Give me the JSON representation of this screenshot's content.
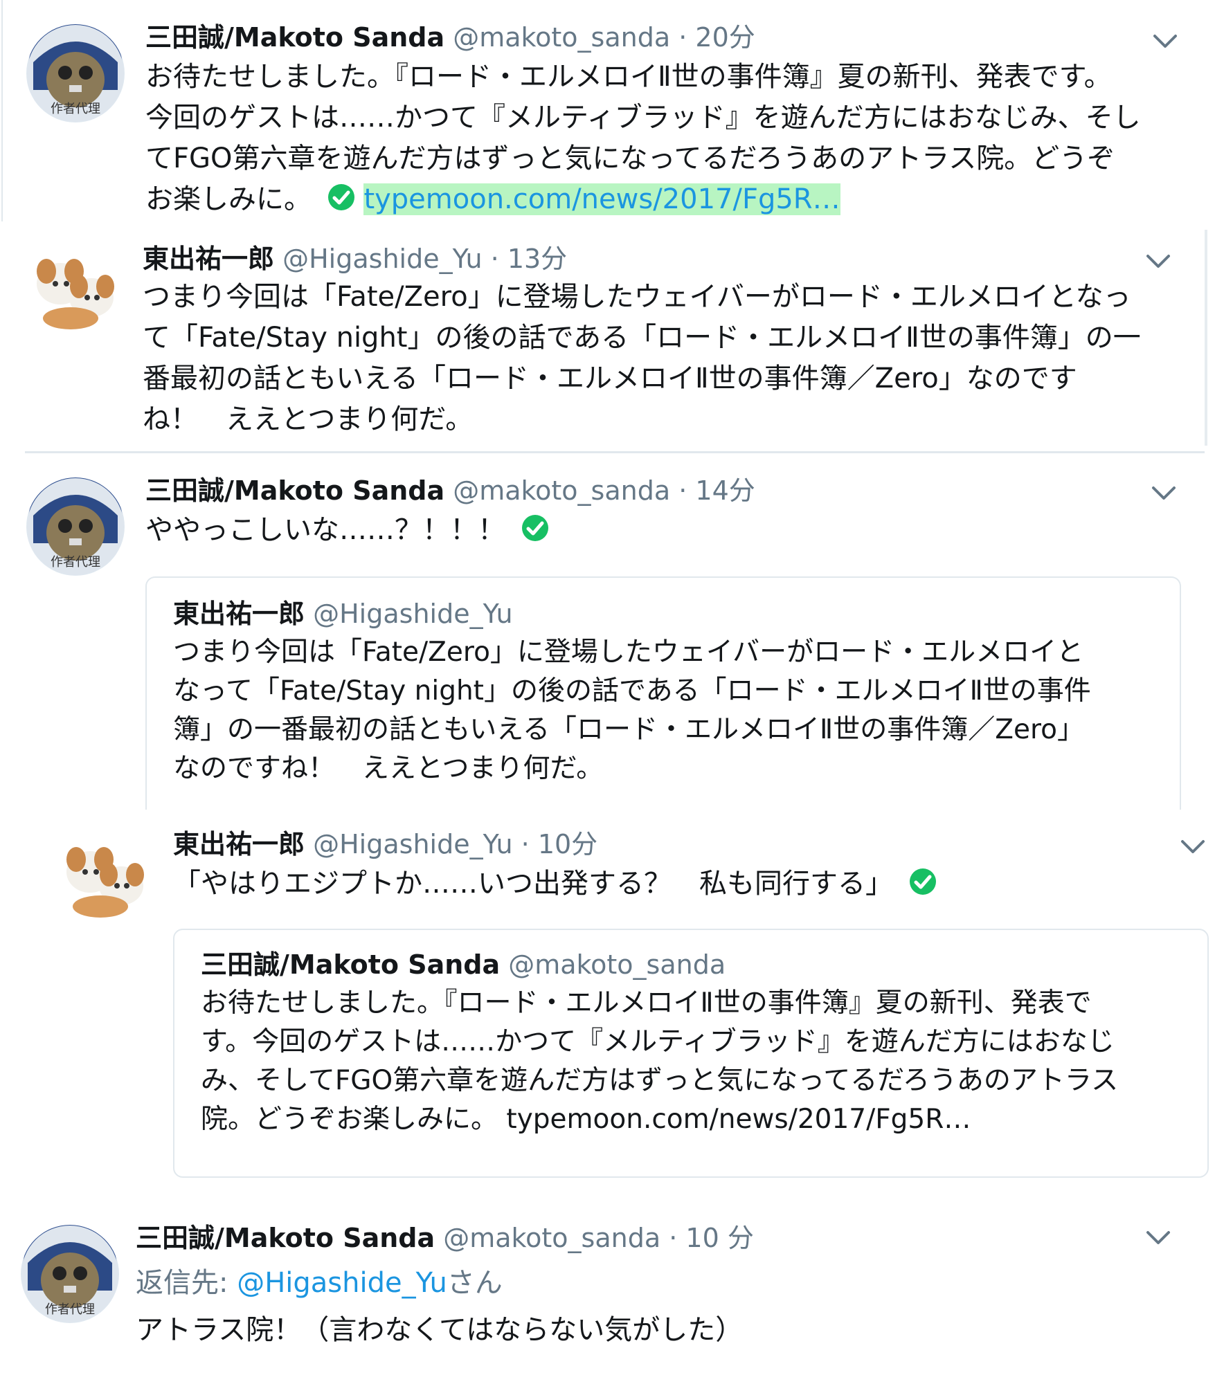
{
  "tweets": [
    {
      "name": "三田誠/Makoto Sanda",
      "handle": "@makoto_sanda",
      "sep": "·",
      "time": "20分",
      "lines": [
        "お待たせしました。『ロード・エルメロイⅡ世の事件簿』夏の新刊、発表です。",
        "今回のゲストは……かつて『メルティブラッド』を遊んだ方にはおなじみ、そし",
        "てFGO第六章を遊んだ方はずっと気になってるだろうあのアトラス院。どうぞ"
      ],
      "last_line": "お楽しみに。",
      "link": "typemoon.com/news/2017/Fg5R…",
      "avatar": "owl-avatar"
    },
    {
      "name": "東出祐一郎",
      "handle": "@Higashide_Yu",
      "sep": "·",
      "time": "13分",
      "lines": [
        "つまり今回は「Fate/Zero」に登場したウェイバーがロード・エルメロイとなっ",
        "て「Fate/Stay night」の後の話である「ロード・エルメロイⅡ世の事件簿」の一",
        "番最初の話ともいえる「ロード・エルメロイⅡ世の事件簿／Zero」なのです",
        "ね！　ええとつまり何だ。"
      ],
      "avatar": "dogs-avatar"
    },
    {
      "name": "三田誠/Makoto Sanda",
      "handle": "@makoto_sanda",
      "sep": "·",
      "time": "14分",
      "text": "ややっこしいな……？！！！",
      "quote": {
        "name": "東出祐一郎",
        "handle": "@Higashide_Yu",
        "lines": [
          "つまり今回は「Fate/Zero」に登場したウェイバーがロード・エルメロイと",
          "なって「Fate/Stay night」の後の話である「ロード・エルメロイⅡ世の事件",
          "簿」の一番最初の話ともいえる「ロード・エルメロイⅡ世の事件簿／Zero」",
          "なのですね！　ええとつまり何だ。"
        ]
      },
      "avatar": "owl-avatar"
    },
    {
      "name": "東出祐一郎",
      "handle": "@Higashide_Yu",
      "sep": "·",
      "time": "10分",
      "text": "「やはりエジプトか……いつ出発する？　私も同行する」",
      "quote": {
        "name": "三田誠/Makoto Sanda",
        "handle": "@makoto_sanda",
        "lines": [
          "お待たせしました。『ロード・エルメロイⅡ世の事件簿』夏の新刊、発表で",
          "す。今回のゲストは……かつて『メルティブラッド』を遊んだ方にはおなじ",
          "み、そしてFGO第六章を遊んだ方はずっと気になってるだろうあのアトラス",
          "院。どうぞお楽しみに。 typemoon.com/news/2017/Fg5R…"
        ]
      },
      "avatar": "dogs-avatar"
    },
    {
      "name": "三田誠/Makoto Sanda",
      "handle": "@makoto_sanda",
      "sep": "·",
      "time": "10 分",
      "reply_prefix": "返信先: ",
      "reply_mention": "@Higashide_Yu",
      "reply_suffix": "さん",
      "text": "アトラス院！（言わなくてはならない気がした）",
      "avatar": "owl-avatar"
    }
  ],
  "colors": {
    "link": "#1b95e0",
    "link_highlight": "#b8f5c2",
    "check": "#17bf63",
    "muted": "#657786"
  },
  "icons": [
    "chevron-down-icon",
    "check-circle-icon",
    "owl-avatar",
    "dogs-avatar"
  ]
}
